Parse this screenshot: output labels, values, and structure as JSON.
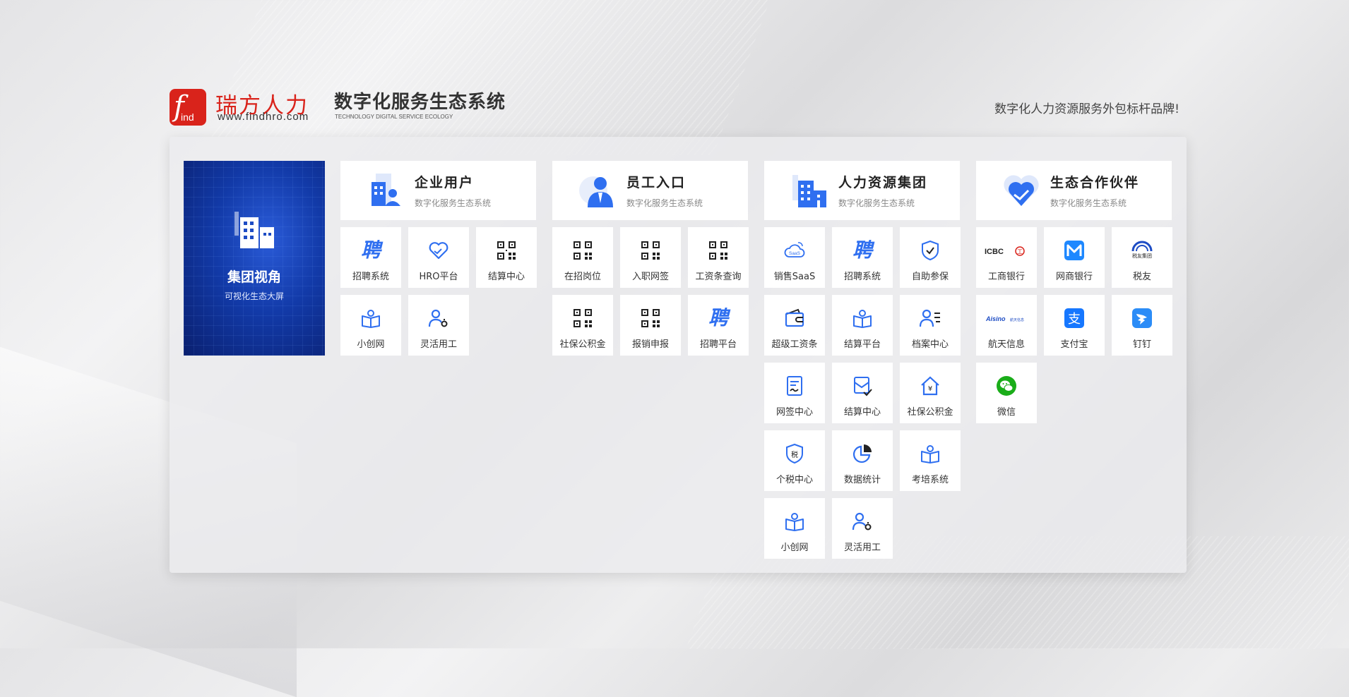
{
  "header": {
    "logo_letter": "f",
    "logo_ind": "ind",
    "brand_name": "瑞方人力",
    "brand_url": "www.findhro.com",
    "title": "数字化服务生态系统",
    "subtitle": "TECHNOLOGY DIGITAL SERVICE ECOLOGY",
    "slogan": "数字化人力资源服务外包标杆品牌!"
  },
  "hero": {
    "title": "集团视角",
    "subtitle": "可视化生态大屏"
  },
  "columns": [
    {
      "title": "企业用户",
      "subtitle": "数字化服务生态系统",
      "tiles": [
        "招聘系统",
        "HRO平台",
        "结算中心",
        "小创网",
        "灵活用工"
      ]
    },
    {
      "title": "员工入口",
      "subtitle": "数字化服务生态系统",
      "tiles": [
        "在招岗位",
        "入职网签",
        "工资条查询",
        "社保公积金",
        "报销申报",
        "招聘平台"
      ]
    },
    {
      "title": "人力资源集团",
      "subtitle": "数字化服务生态系统",
      "tiles": [
        "销售SaaS",
        "招聘系统",
        "自助参保",
        "超级工资条",
        "结算平台",
        "档案中心",
        "网签中心",
        "结算中心",
        "社保公积金",
        "个税中心",
        "数据统计",
        "考培系统",
        "小创网",
        "灵活用工"
      ]
    },
    {
      "title": "生态合作伙伴",
      "subtitle": "数字化服务生态系统",
      "tiles": [
        "工商银行",
        "网商银行",
        "税友",
        "航天信息",
        "支付宝",
        "钉钉",
        "微信"
      ]
    }
  ],
  "icon_glyphs": {
    "pin": "聘",
    "tax": "税",
    "yen": "¥",
    "saas": "SaaS",
    "icbc": "ICBC",
    "icbc_mark": "工",
    "aisino": "Aisino",
    "aisino_sub": "航天信息",
    "shuiyou_sub": "税友集团",
    "alipay": "支"
  },
  "colors": {
    "brand_red": "#d9231b",
    "accent_blue": "#2f6ff0",
    "hero_blue": "#123aa8",
    "wechat_green": "#1aad19",
    "alipay_blue": "#1677ff"
  }
}
